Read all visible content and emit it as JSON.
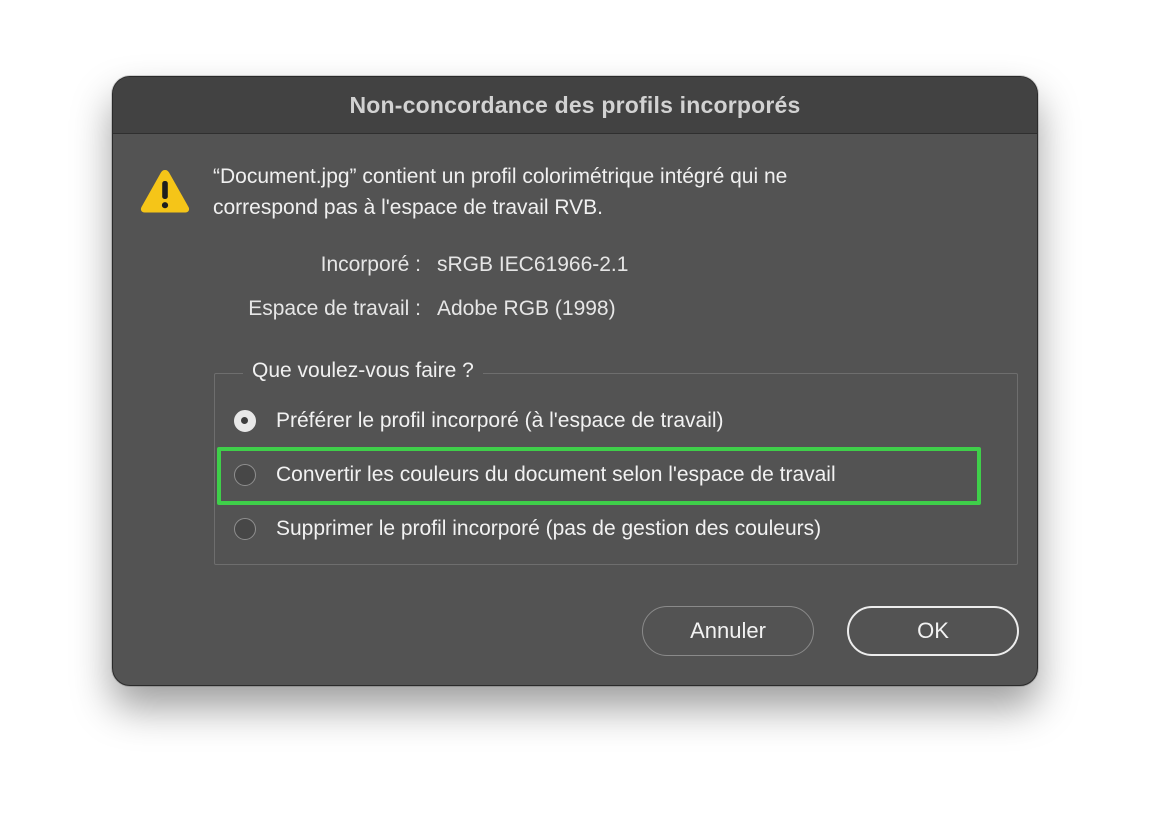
{
  "dialog": {
    "title": "Non-concordance des profils incorporés",
    "message_line1": "“Document.jpg” contient un profil colorimétrique intégré qui ne",
    "message_line2": "correspond pas à l'espace de travail RVB.",
    "icon": "warning-icon",
    "accent_color": "#f5c518"
  },
  "profiles": {
    "embedded_label": "Incorporé :",
    "embedded_value": "sRGB IEC61966-2.1",
    "working_label": "Espace de travail :",
    "working_value": "Adobe RGB (1998)"
  },
  "options": {
    "legend": "Que voulez-vous faire ?",
    "items": [
      {
        "label": "Préférer le profil incorporé (à l'espace de travail)",
        "selected": true
      },
      {
        "label": "Convertir les couleurs du document selon l'espace de travail",
        "selected": false,
        "highlighted": true
      },
      {
        "label": "Supprimer le profil incorporé (pas de gestion des couleurs)",
        "selected": false
      }
    ],
    "highlight_color": "#3fcf4a"
  },
  "buttons": {
    "cancel_label": "Annuler",
    "ok_label": "OK"
  }
}
